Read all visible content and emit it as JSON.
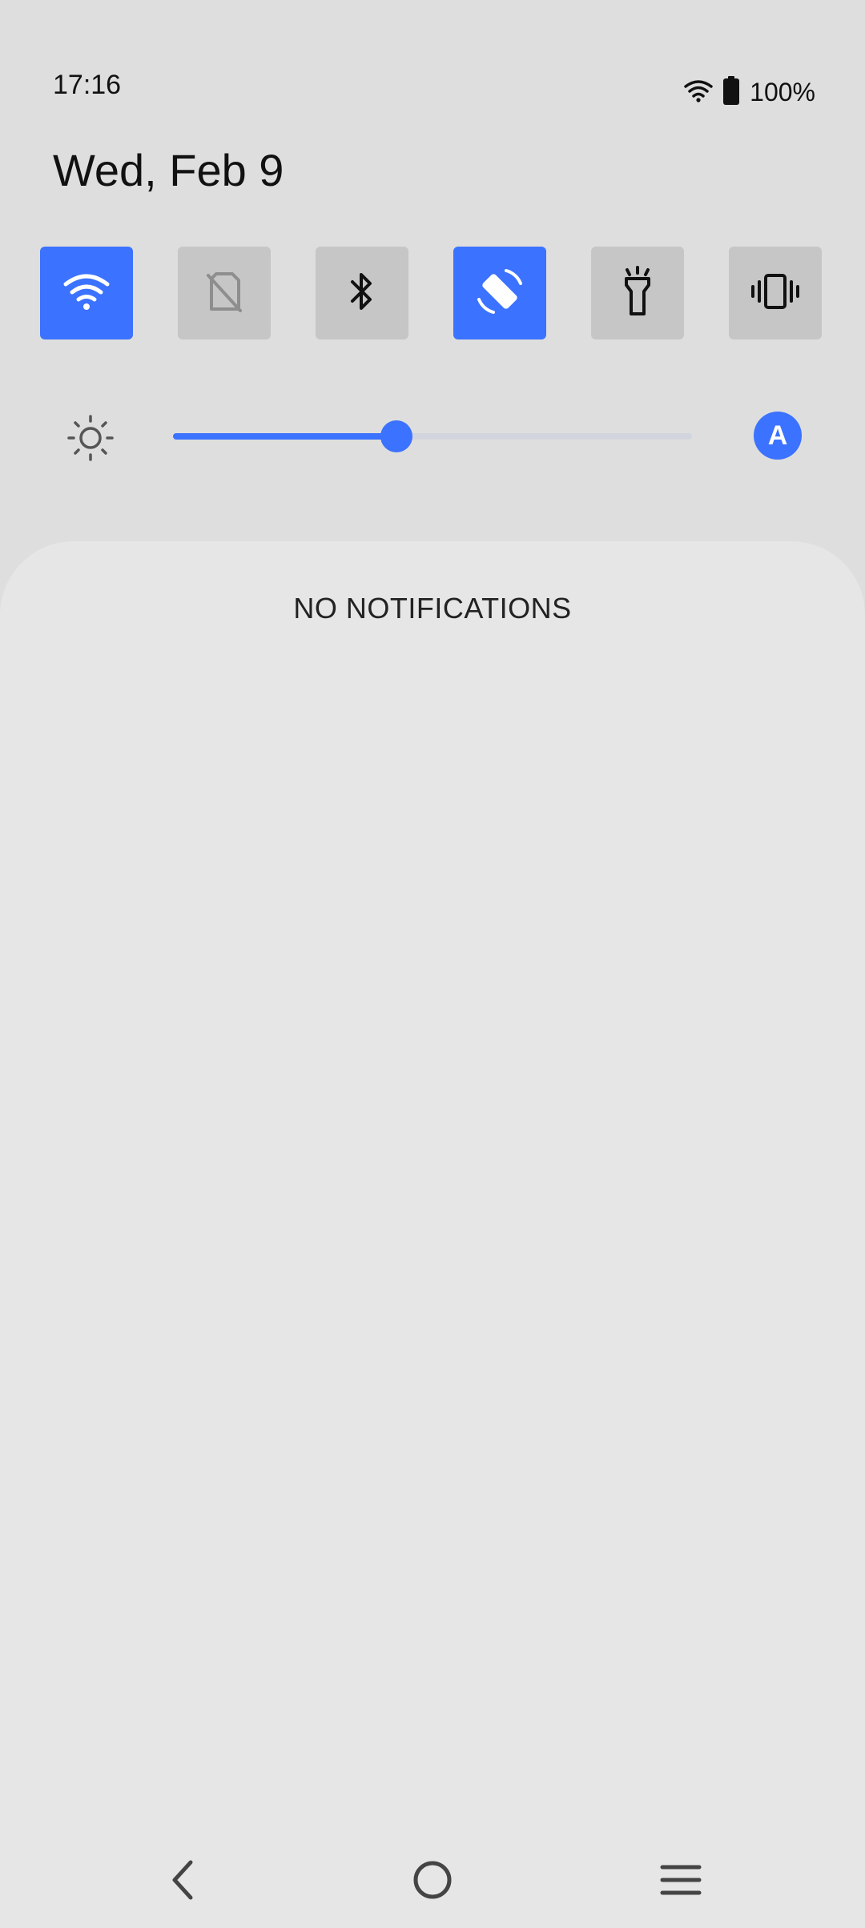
{
  "status_bar": {
    "time": "17:16",
    "battery_percent": "100%",
    "icons": [
      "wifi-signal-icon",
      "battery-full-icon"
    ]
  },
  "header": {
    "date": "Wed, Feb 9"
  },
  "quick_settings": {
    "tiles": [
      {
        "id": "wifi",
        "icon": "wifi-icon",
        "active": true
      },
      {
        "id": "mobile-data",
        "icon": "no-sim-icon",
        "active": false
      },
      {
        "id": "bluetooth",
        "icon": "bluetooth-icon",
        "active": false
      },
      {
        "id": "auto-rotate",
        "icon": "screen-rotation-icon",
        "active": true
      },
      {
        "id": "flashlight",
        "icon": "flashlight-icon",
        "active": false
      },
      {
        "id": "vibrate",
        "icon": "vibrate-icon",
        "active": false
      }
    ]
  },
  "brightness": {
    "level": 0.43,
    "auto_label": "A",
    "icon": "brightness-icon"
  },
  "notifications": {
    "empty_text": "NO NOTIFICATIONS"
  },
  "navigation": {
    "buttons": [
      "back-icon",
      "home-icon",
      "recents-menu-icon"
    ]
  },
  "colors": {
    "accent": "#3b72ff",
    "tile_inactive": "#c6c6c6",
    "background": "#dedede",
    "panel": "#e6e6e6"
  }
}
